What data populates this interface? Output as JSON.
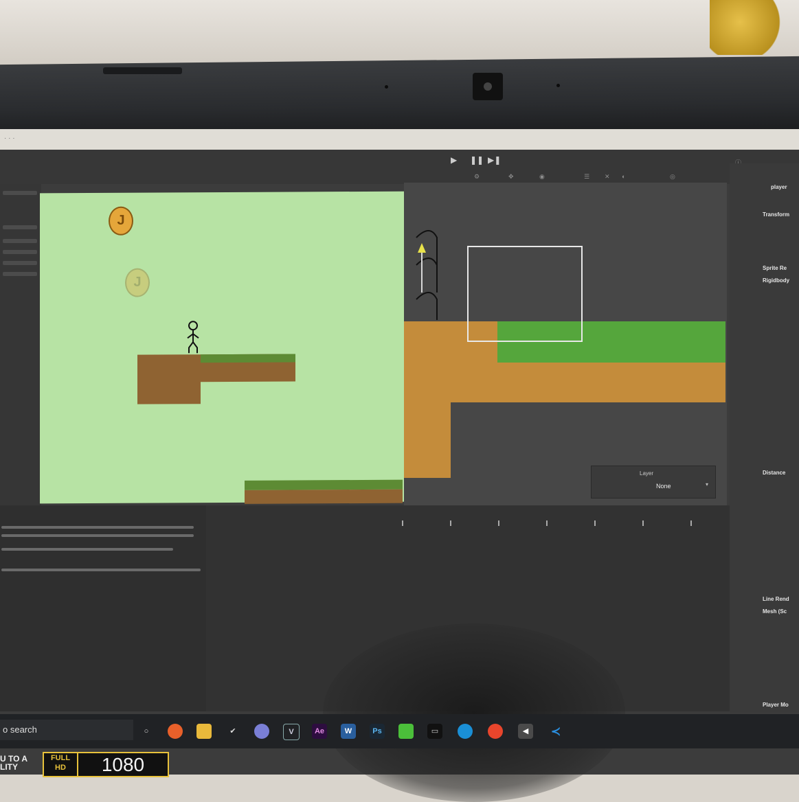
{
  "game_view": {
    "coin_symbol": "J"
  },
  "scene_view": {
    "layer_dropdown": {
      "label": "Layer",
      "value": "None"
    }
  },
  "inspector": {
    "lines": [
      "player",
      "Transform",
      "Sprite Re",
      "Rigidbody",
      "Distance",
      "Line Rend",
      "Mesh (Sc",
      "Player Mo"
    ]
  },
  "taskbar": {
    "search_text": "o search"
  },
  "watermark": {
    "line1": "U TO A",
    "line2": "LITY",
    "full": "FULL",
    "hd": "HD",
    "resolution": "1080"
  }
}
